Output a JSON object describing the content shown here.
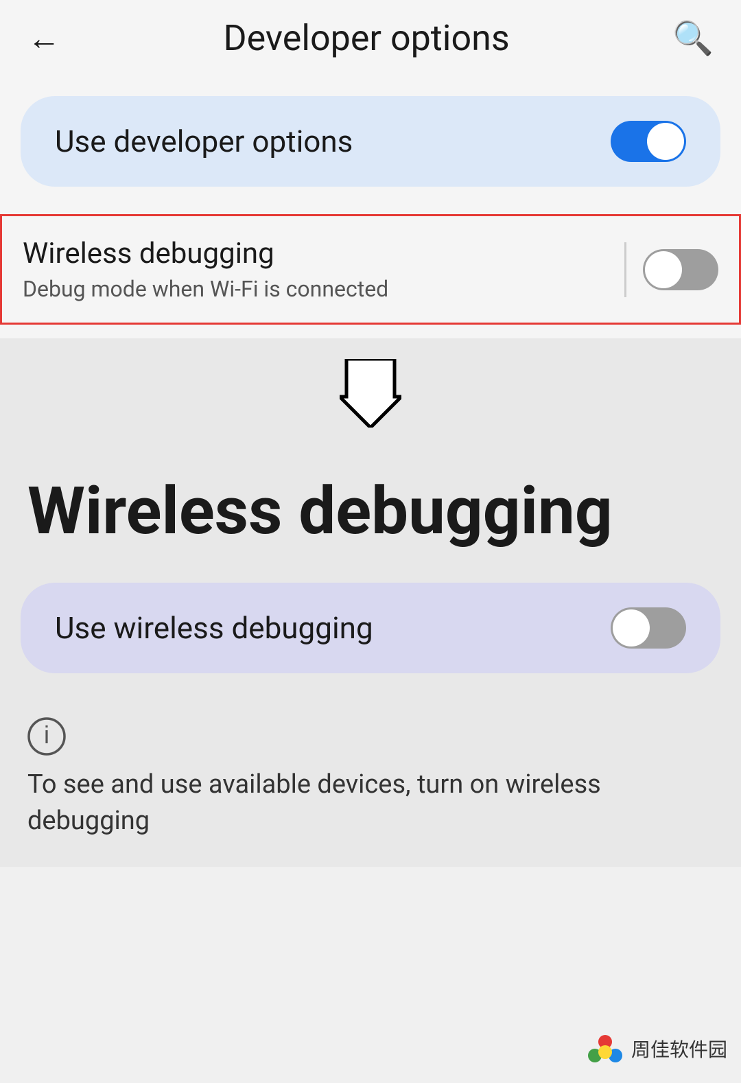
{
  "header": {
    "back_label": "←",
    "title": "Developer options",
    "search_label": "🔍"
  },
  "developer_options_card": {
    "label": "Use developer options",
    "toggle_state": "on"
  },
  "wireless_debug_row": {
    "title": "Wireless debugging",
    "subtitle": "Debug mode when Wi-Fi is connected",
    "toggle_state": "off"
  },
  "wireless_debug_page": {
    "title": "Wireless debugging",
    "card_label": "Use wireless debugging",
    "toggle_state": "off"
  },
  "info": {
    "text": "To see and use available devices, turn on wireless debugging"
  },
  "watermark": {
    "text": "周佳软件园"
  }
}
